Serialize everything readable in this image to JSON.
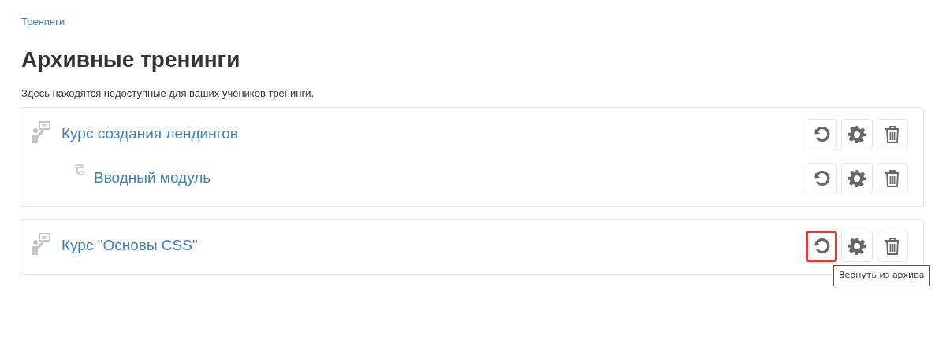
{
  "breadcrumb": "Тренинги",
  "title": "Архивные тренинги",
  "description": "Здесь находятся недоступные для ваших учеников тренинги.",
  "cards": [
    {
      "items": [
        {
          "kind": "course",
          "title": "Курс создания лендингов",
          "restore_highlighted": false
        },
        {
          "kind": "module",
          "title": "Вводный модуль",
          "restore_highlighted": false
        }
      ]
    },
    {
      "items": [
        {
          "kind": "course",
          "title": "Курс \"Основы CSS\"",
          "restore_highlighted": true
        }
      ]
    }
  ],
  "tooltip": "Вернуть из архива"
}
